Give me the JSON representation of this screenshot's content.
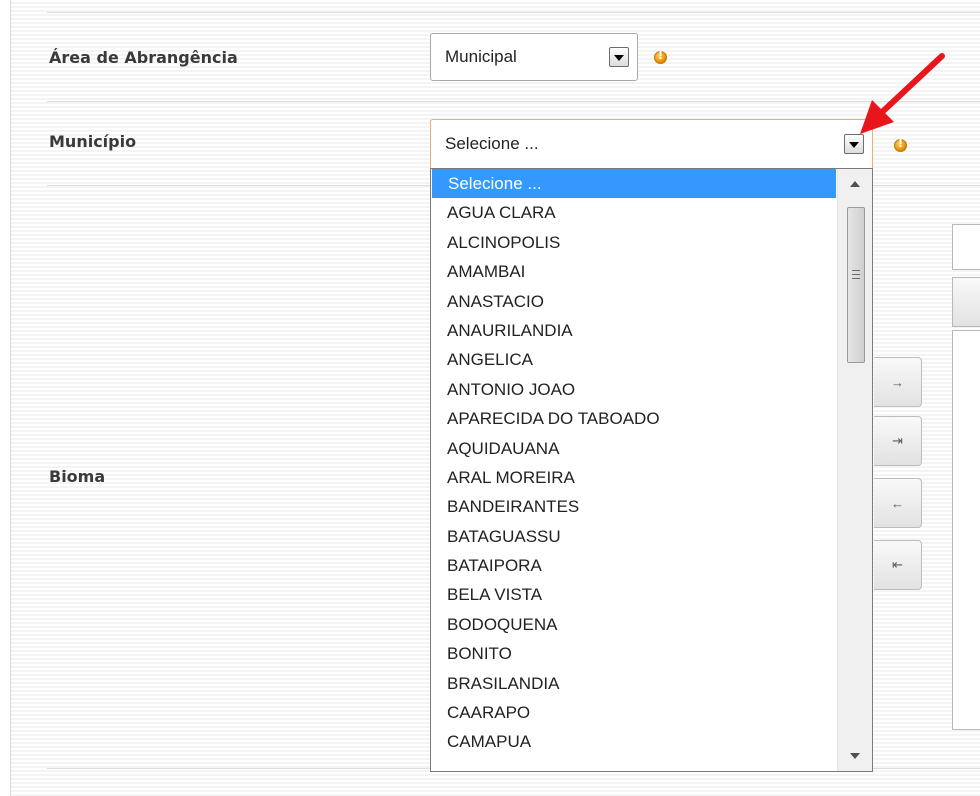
{
  "form": {
    "area_label": "Área de Abrangência",
    "area_value": "Municipal",
    "municipio_label": "Município",
    "municipio_value": "Selecione ...",
    "bioma_label": "Bioma",
    "warning_glyph": "!"
  },
  "dropdown": {
    "selected_index": 0,
    "options": [
      "Selecione ...",
      "AGUA CLARA",
      "ALCINOPOLIS",
      "AMAMBAI",
      "ANASTACIO",
      "ANAURILANDIA",
      "ANGELICA",
      "ANTONIO JOAO",
      "APARECIDA DO TABOADO",
      "AQUIDAUANA",
      "ARAL MOREIRA",
      "BANDEIRANTES",
      "BATAGUASSU",
      "BATAIPORA",
      "BELA VISTA",
      "BODOQUENA",
      "BONITO",
      "BRASILANDIA",
      "CAARAPO",
      "CAMAPUA"
    ]
  },
  "move_buttons": [
    {
      "name": "move-right-button",
      "glyph": "→"
    },
    {
      "name": "move-all-right-button",
      "glyph": "⇥"
    },
    {
      "name": "move-left-button",
      "glyph": "←"
    },
    {
      "name": "move-all-left-button",
      "glyph": "⇤"
    }
  ],
  "colors": {
    "selection": "#3399ff",
    "annotation_arrow": "#e8161c",
    "warning": "#f0a020",
    "focus_border": "#e2b36a"
  }
}
